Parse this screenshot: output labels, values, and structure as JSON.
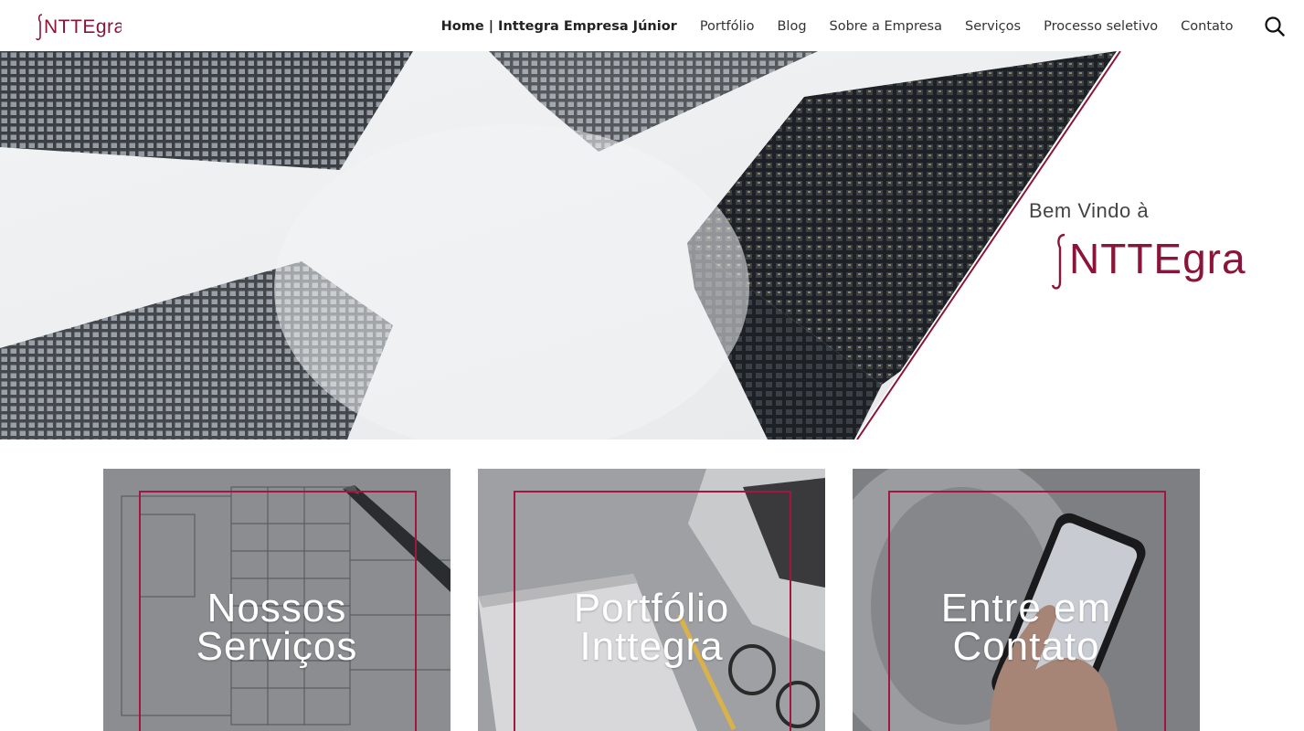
{
  "header": {
    "logo_text": "Inttegra",
    "nav": [
      {
        "label": "Home | Inttegra Empresa Júnior"
      },
      {
        "label": "Portfólio"
      },
      {
        "label": "Blog"
      },
      {
        "label": "Sobre a Empresa"
      },
      {
        "label": "Serviços"
      },
      {
        "label": "Processo seletivo"
      },
      {
        "label": "Contato"
      }
    ],
    "search_icon": "search-icon"
  },
  "hero": {
    "welcome": "Bem Vindo à",
    "brand": "Inttegra"
  },
  "cards": [
    {
      "line1": "Nossos",
      "line2": "Serviços"
    },
    {
      "line1": "Portfólio",
      "line2": "Inttegra"
    },
    {
      "line1": "Entre em",
      "line2": "Contato"
    }
  ],
  "colors": {
    "brand": "#8a1538",
    "frame": "#a3163f"
  }
}
